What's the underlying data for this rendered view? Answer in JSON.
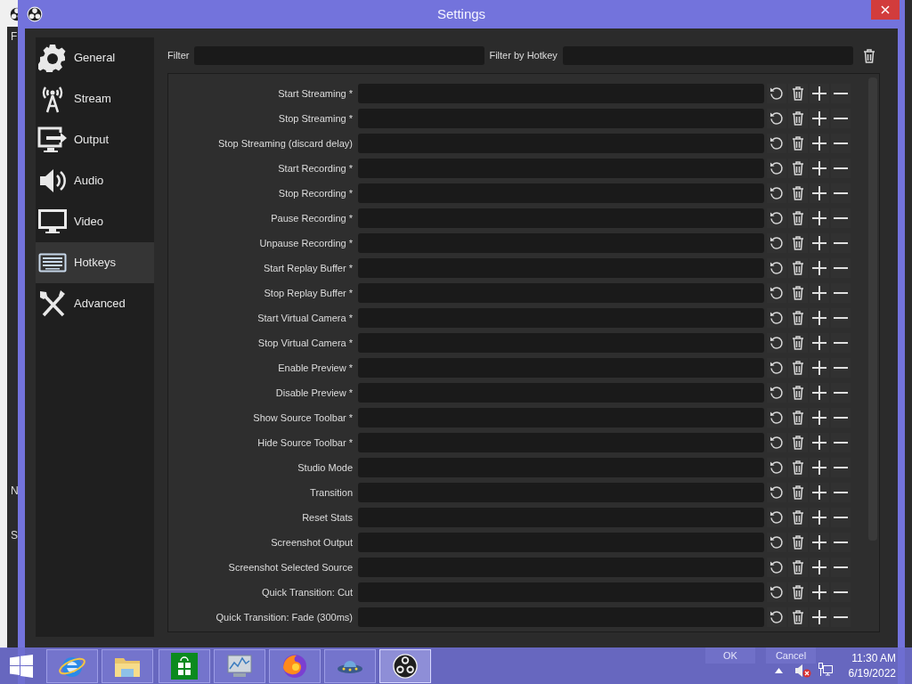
{
  "background_window": {
    "texts": [
      "F",
      "N",
      "S"
    ]
  },
  "window": {
    "title": "Settings"
  },
  "sidebar": {
    "items": [
      {
        "label": "General",
        "selected": false
      },
      {
        "label": "Stream",
        "selected": false
      },
      {
        "label": "Output",
        "selected": false
      },
      {
        "label": "Audio",
        "selected": false
      },
      {
        "label": "Video",
        "selected": false
      },
      {
        "label": "Hotkeys",
        "selected": true
      },
      {
        "label": "Advanced",
        "selected": false
      }
    ]
  },
  "filters": [
    {
      "label": "Filter"
    },
    {
      "label": "Filter by Hotkey"
    }
  ],
  "hotkeys": [
    {
      "label": "Start Streaming *"
    },
    {
      "label": "Stop Streaming *"
    },
    {
      "label": "Stop Streaming (discard delay)"
    },
    {
      "label": "Start Recording *"
    },
    {
      "label": "Stop Recording *"
    },
    {
      "label": "Pause Recording *"
    },
    {
      "label": "Unpause Recording *"
    },
    {
      "label": "Start Replay Buffer *"
    },
    {
      "label": "Stop Replay Buffer *"
    },
    {
      "label": "Start Virtual Camera *"
    },
    {
      "label": "Stop Virtual Camera *"
    },
    {
      "label": "Enable Preview *"
    },
    {
      "label": "Disable Preview *"
    },
    {
      "label": "Show Source Toolbar *"
    },
    {
      "label": "Hide Source Toolbar *"
    },
    {
      "label": "Studio Mode"
    },
    {
      "label": "Transition"
    },
    {
      "label": "Reset Stats"
    },
    {
      "label": "Screenshot Output"
    },
    {
      "label": "Screenshot Selected Source"
    },
    {
      "label": "Quick Transition: Cut"
    },
    {
      "label": "Quick Transition: Fade (300ms)"
    }
  ],
  "buttons": [
    "OK",
    "Cancel"
  ],
  "taskbar": {
    "apps": [
      {
        "selected": false
      },
      {
        "selected": false
      },
      {
        "selected": false
      },
      {
        "selected": false
      },
      {
        "selected": false
      },
      {
        "selected": false
      },
      {
        "selected": true
      }
    ],
    "time": "11:30 AM",
    "date": "6/19/2022"
  }
}
